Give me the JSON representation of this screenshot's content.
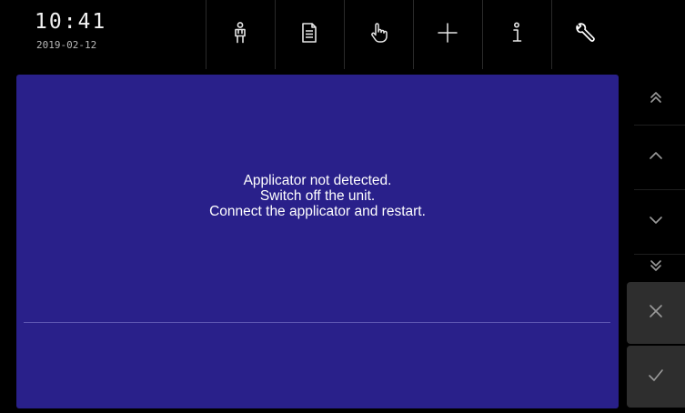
{
  "status": {
    "time": "10:41",
    "date": "2019-02-12"
  },
  "toolbar": {
    "icons": [
      "person-icon",
      "document-icon",
      "hand-pointer-icon",
      "plus-icon",
      "info-icon",
      "wrench-icon"
    ]
  },
  "message": {
    "lines": [
      "Applicator not detected.",
      "Switch off the unit.",
      "Connect the applicator and restart."
    ]
  },
  "sidebar": {
    "icons": [
      "double-chevron-up-icon",
      "chevron-up-icon",
      "chevron-down-icon",
      "double-chevron-down-icon",
      "cancel-icon",
      "confirm-icon"
    ]
  },
  "colors": {
    "panel": "#29208a",
    "background": "#000000",
    "action_button": "#2e2e2e",
    "icon_light": "#e6e6e6",
    "icon_dim": "#9a9a9a"
  }
}
